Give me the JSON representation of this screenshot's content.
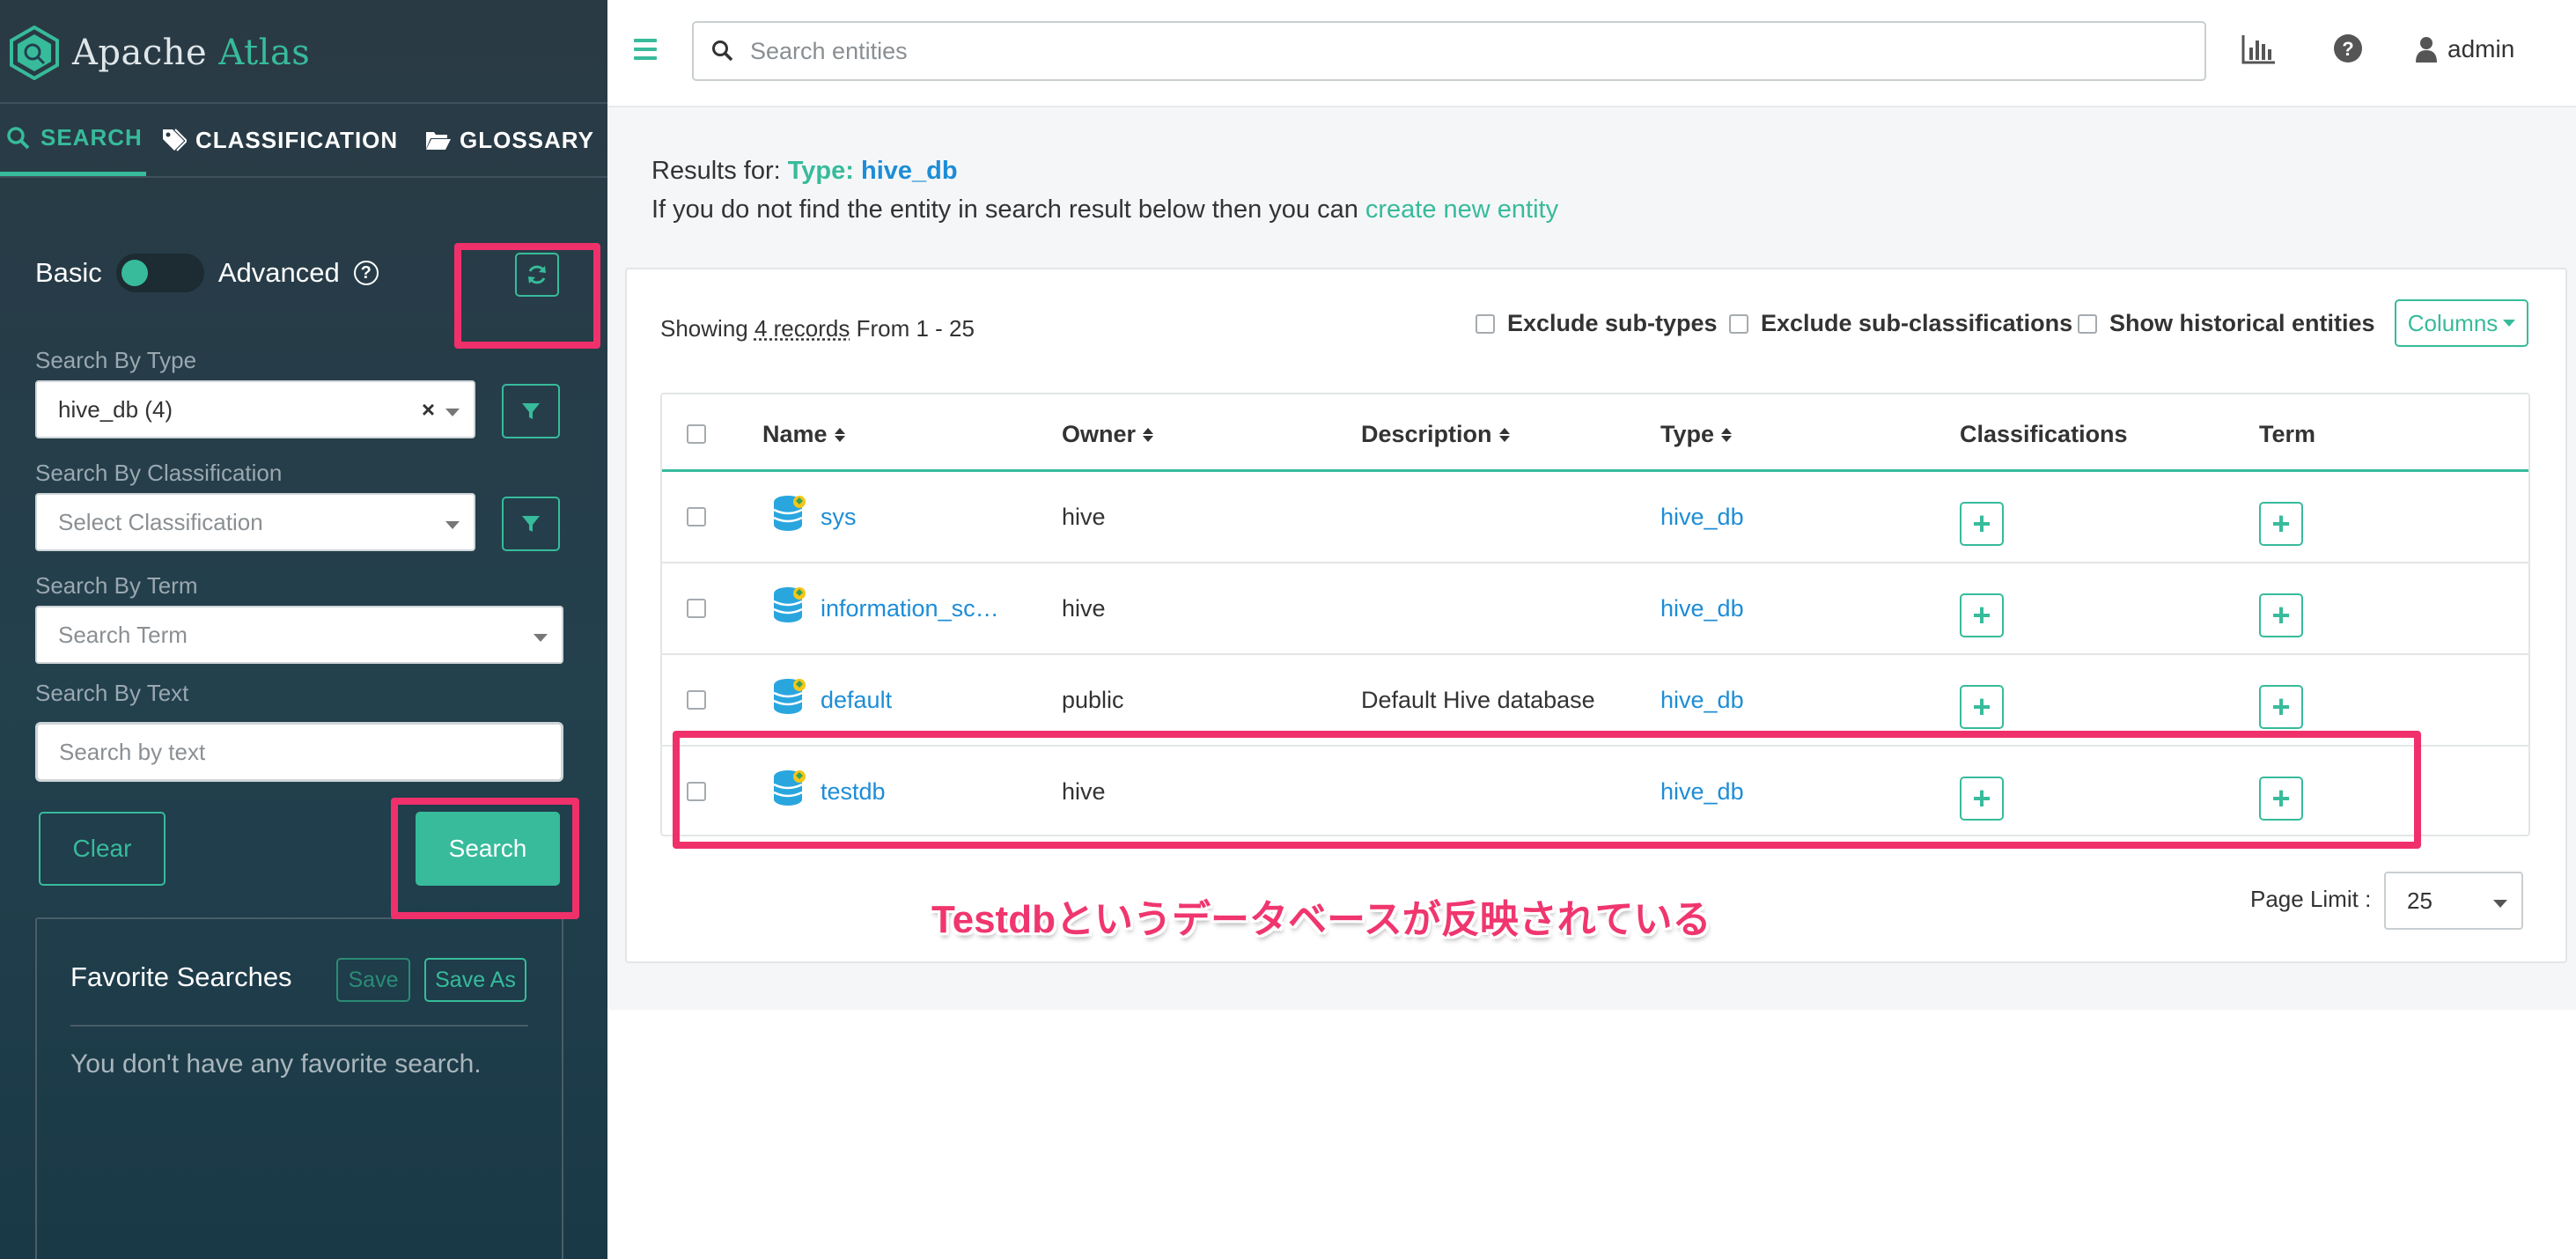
{
  "brand": {
    "name": "Apache",
    "accent": "Atlas"
  },
  "sidebar": {
    "tabs": [
      {
        "label": "SEARCH",
        "icon": "search-icon",
        "active": true
      },
      {
        "label": "CLASSIFICATION",
        "icon": "tag-icon",
        "active": false
      },
      {
        "label": "GLOSSARY",
        "icon": "folder-open-icon",
        "active": false
      }
    ],
    "mode": {
      "basic": "Basic",
      "advanced": "Advanced",
      "selected": "Basic"
    },
    "search_by_type": {
      "label": "Search By Type",
      "value": "hive_db (4)",
      "clear": "×"
    },
    "search_by_classification": {
      "label": "Search By Classification",
      "placeholder": "Select Classification"
    },
    "search_by_term": {
      "label": "Search By Term",
      "placeholder": "Search Term"
    },
    "search_by_text": {
      "label": "Search By Text",
      "placeholder": "Search by text",
      "value": ""
    },
    "clear_label": "Clear",
    "search_label": "Search",
    "favorites": {
      "title": "Favorite Searches",
      "save_label": "Save",
      "save_as_label": "Save As",
      "empty_text": "You don't have any favorite search."
    }
  },
  "topbar": {
    "search_placeholder": "Search entities",
    "user": "admin"
  },
  "results": {
    "prefix": "Results for:",
    "type_label": "Type:",
    "type_value": "hive_db",
    "not_found_text": "If you do not find the entity in search result below then you can",
    "create_link": "create new entity",
    "showing_prefix": "Showing",
    "showing_records": "4 records",
    "showing_range": "From 1 - 25",
    "options": [
      "Exclude sub-types",
      "Exclude sub-classifications",
      "Show historical entities"
    ],
    "columns_label": "Columns",
    "headers": [
      "Name",
      "Owner",
      "Description",
      "Type",
      "Classifications",
      "Term"
    ],
    "rows": [
      {
        "name": "sys",
        "owner": "hive",
        "description": "",
        "type": "hive_db"
      },
      {
        "name": "information_sc…",
        "owner": "hive",
        "description": "",
        "type": "hive_db"
      },
      {
        "name": "default",
        "owner": "public",
        "description": "Default Hive database",
        "type": "hive_db"
      },
      {
        "name": "testdb",
        "owner": "hive",
        "description": "",
        "type": "hive_db"
      }
    ],
    "plus": "+",
    "page_limit_label": "Page Limit :",
    "page_limit_value": "25"
  },
  "annotation": {
    "text": "Testdbというデータベースが反映されている",
    "color": "#f0306b"
  },
  "colors": {
    "accent": "#37bb9b",
    "link": "#1d8dd6",
    "sidebar": "#23404d"
  }
}
